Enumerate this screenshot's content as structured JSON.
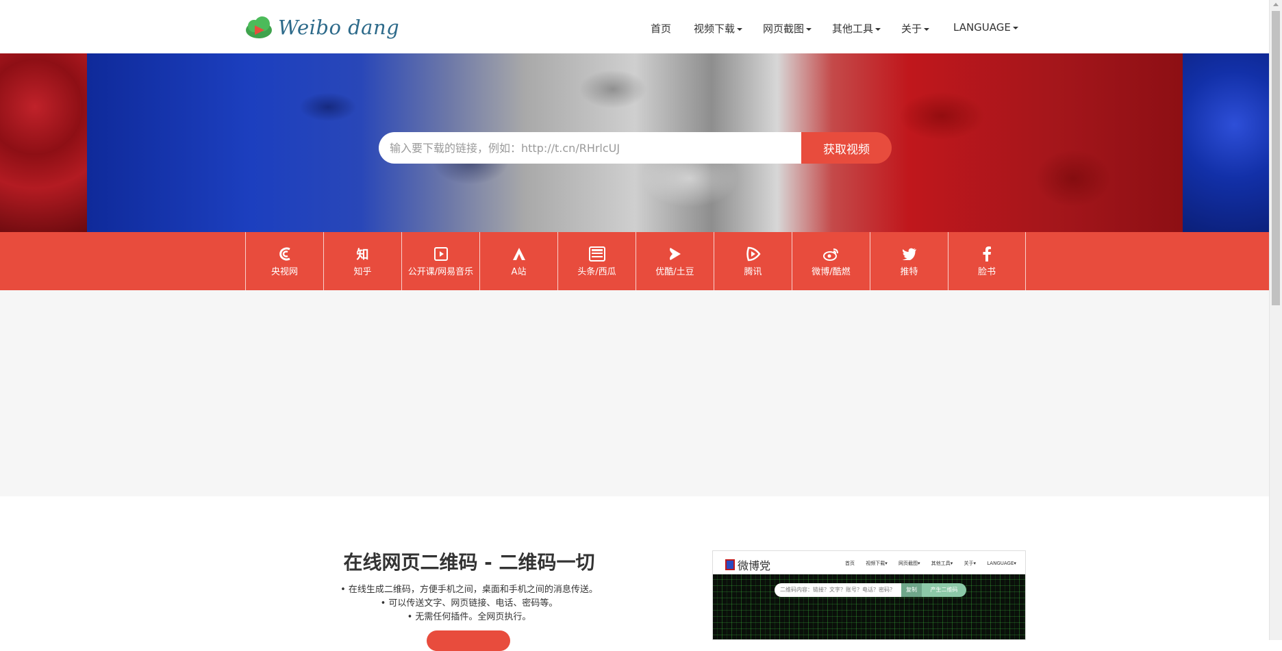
{
  "brand": {
    "name": "Weibo dang"
  },
  "nav": {
    "items": [
      {
        "label": "首页",
        "dropdown": false
      },
      {
        "label": "视频下载",
        "dropdown": true
      },
      {
        "label": "网页截图",
        "dropdown": true
      },
      {
        "label": "其他工具",
        "dropdown": true
      },
      {
        "label": "关于",
        "dropdown": true
      },
      {
        "label": "LANGUAGE",
        "dropdown": true
      }
    ]
  },
  "search": {
    "placeholder": "输入要下载的链接，例如：http://t.cn/RHrlcUJ",
    "button_label": "获取视频"
  },
  "platforms": [
    {
      "label": "央视网",
      "icon": "cctv-icon"
    },
    {
      "label": "知乎",
      "icon": "zhihu-icon"
    },
    {
      "label": "公开课/网易音乐",
      "icon": "play-square-icon"
    },
    {
      "label": "A站",
      "icon": "acfun-icon"
    },
    {
      "label": "头条/西瓜",
      "icon": "toutiao-icon"
    },
    {
      "label": "优酷/土豆",
      "icon": "youku-icon"
    },
    {
      "label": "腾讯",
      "icon": "tencent-video-icon"
    },
    {
      "label": "微博/酷燃",
      "icon": "weibo-icon"
    },
    {
      "label": "推特",
      "icon": "twitter-icon"
    },
    {
      "label": "脸书",
      "icon": "facebook-icon"
    }
  ],
  "feature": {
    "title": "在线网页二维码 - 二维码一切",
    "bullets": [
      "在线生成二维码，方便手机之间，桌面和手机之间的消息传送。",
      "可以传送文字、网页链接、电话、密码等。",
      "无需任何插件。全网页执行。"
    ]
  },
  "preview": {
    "logo": "微博党",
    "nav": [
      "首页",
      "视频下载▾",
      "网页截图▾",
      "其他工具▾",
      "关于▾",
      "LANGUAGE▾"
    ],
    "input_placeholder": "二维码内容：链接？文字？账号？电话？密码？",
    "copy_label": "复制",
    "generate_label": "产生二维码"
  },
  "colors": {
    "accent": "#e84c3d"
  }
}
